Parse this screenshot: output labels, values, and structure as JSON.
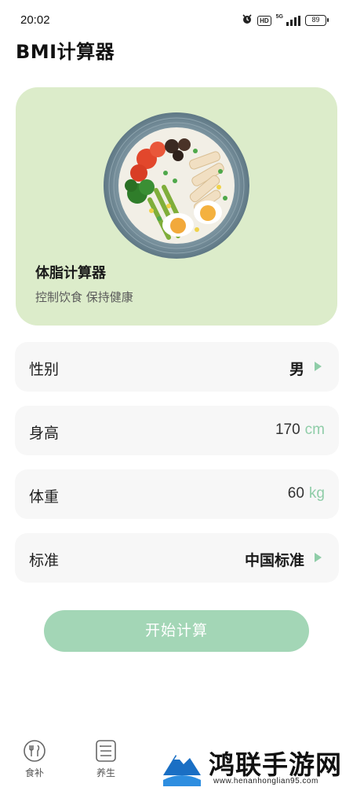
{
  "status_bar": {
    "time": "20:02",
    "hd": "HD",
    "network": "5G",
    "battery": "89"
  },
  "page": {
    "title": "BMI计算器"
  },
  "hero": {
    "title": "体脂计算器",
    "subtitle": "控制饮食 保持健康",
    "background_color": "#dcecca"
  },
  "form": {
    "gender": {
      "label": "性别",
      "value": "男"
    },
    "height": {
      "label": "身高",
      "value": "170",
      "unit": "cm"
    },
    "weight": {
      "label": "体重",
      "value": "60",
      "unit": "kg"
    },
    "standard": {
      "label": "标准",
      "value": "中国标准"
    }
  },
  "actions": {
    "start_label": "开始计算",
    "accent_color": "#a3d6b6"
  },
  "tabbar": {
    "items": [
      {
        "label": "食补",
        "icon": "food-icon"
      },
      {
        "label": "养生",
        "icon": "list-icon"
      }
    ]
  },
  "watermark": {
    "text": "鸿联手游网",
    "url": "www.henanhonglian95.com"
  }
}
